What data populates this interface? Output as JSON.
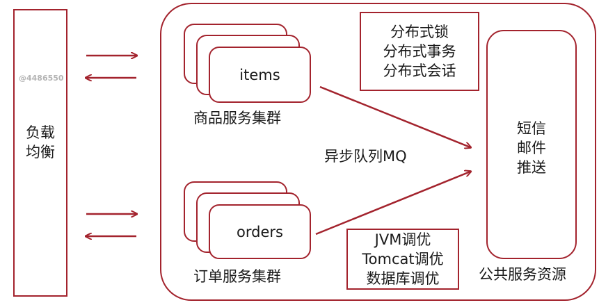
{
  "load_balancer": {
    "line1": "负载",
    "line2": "均衡"
  },
  "watermark": "@4486550",
  "items_cluster": {
    "node_label": "items",
    "caption": "商品服务集群"
  },
  "orders_cluster": {
    "node_label": "orders",
    "caption": "订单服务集群"
  },
  "distributed_box": {
    "lines": [
      "分布式锁",
      "分布式事务",
      "分布式会话"
    ]
  },
  "tuning_box": {
    "lines": [
      "JVM调优",
      "Tomcat调优",
      "数据库调优"
    ]
  },
  "queue_label": "异步队列MQ",
  "public_services": {
    "lines": [
      "短信",
      "邮件",
      "推送"
    ],
    "caption": "公共服务资源"
  },
  "colors": {
    "stroke": "#a3232d",
    "text": "#1a1a1a"
  }
}
